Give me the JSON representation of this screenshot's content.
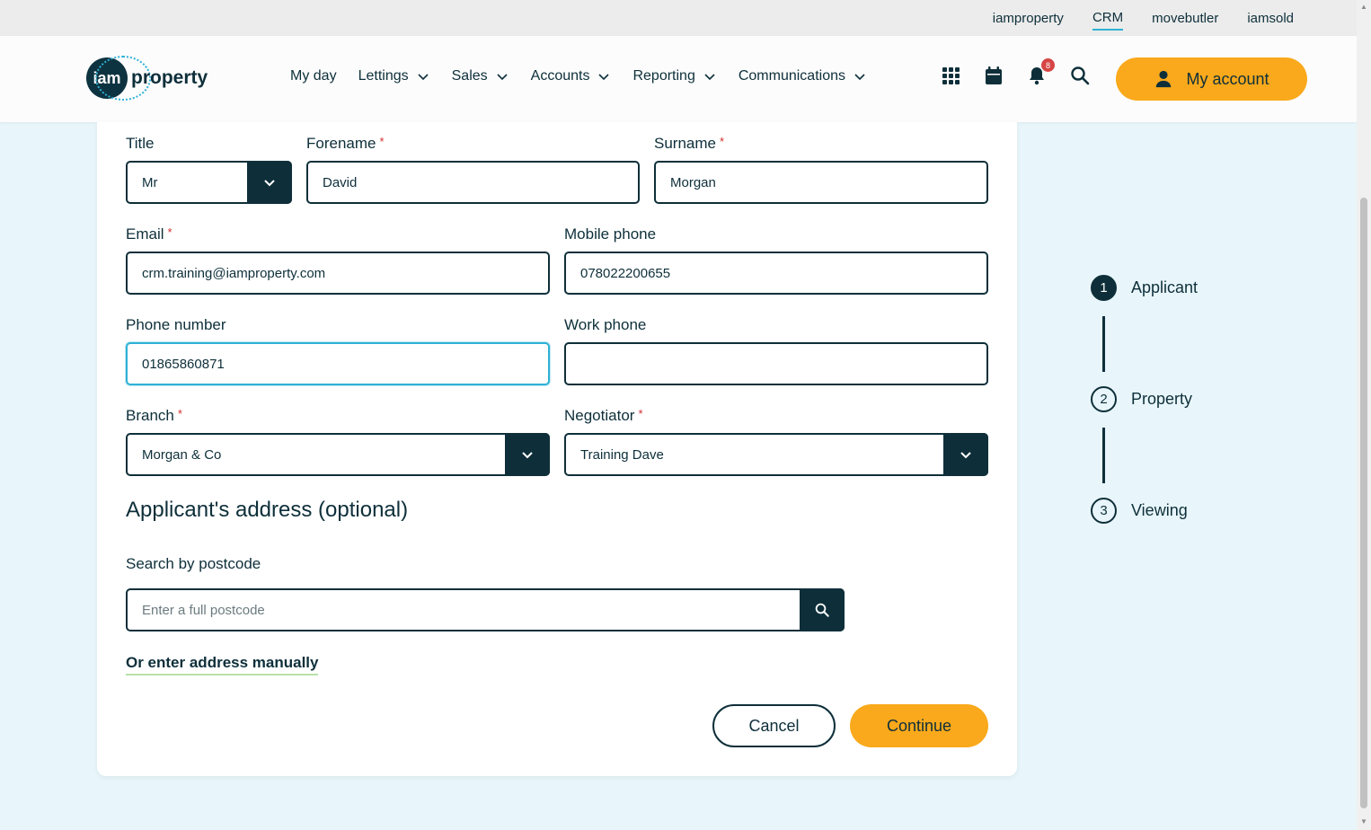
{
  "topbar": {
    "links": [
      "iamproperty",
      "CRM",
      "movebutler",
      "iamsold"
    ],
    "active": "CRM"
  },
  "header": {
    "logo_mark": "iam",
    "logo_word": "property",
    "nav": [
      "My day",
      "Lettings",
      "Sales",
      "Accounts",
      "Reporting",
      "Communications"
    ],
    "notification_count": "8",
    "account_label": "My account"
  },
  "form": {
    "title_label": "Title",
    "title_value": "Mr",
    "forename_label": "Forename",
    "forename_value": "David",
    "surname_label": "Surname",
    "surname_value": "Morgan",
    "email_label": "Email",
    "email_value": "crm.training@iamproperty.com",
    "mobile_label": "Mobile phone",
    "mobile_value": "078022200655",
    "phone_label": "Phone number",
    "phone_value": "01865860871",
    "work_label": "Work phone",
    "work_value": "",
    "branch_label": "Branch",
    "branch_value": "Morgan & Co",
    "negotiator_label": "Negotiator",
    "negotiator_value": "Training Dave",
    "required_marker": "*"
  },
  "address": {
    "section_title": "Applicant's address (optional)",
    "postcode_label": "Search by postcode",
    "postcode_placeholder": "Enter a full postcode",
    "manual_link": "Or enter address manually"
  },
  "actions": {
    "cancel": "Cancel",
    "continue": "Continue"
  },
  "steps": [
    {
      "number": "1",
      "label": "Applicant",
      "active": true
    },
    {
      "number": "2",
      "label": "Property",
      "active": false
    },
    {
      "number": "3",
      "label": "Viewing",
      "active": false
    }
  ],
  "colors": {
    "primary": "#0e2f3a",
    "accent": "#f9a91b",
    "focus": "#2fb1d6",
    "background": "#e8f6fb"
  }
}
